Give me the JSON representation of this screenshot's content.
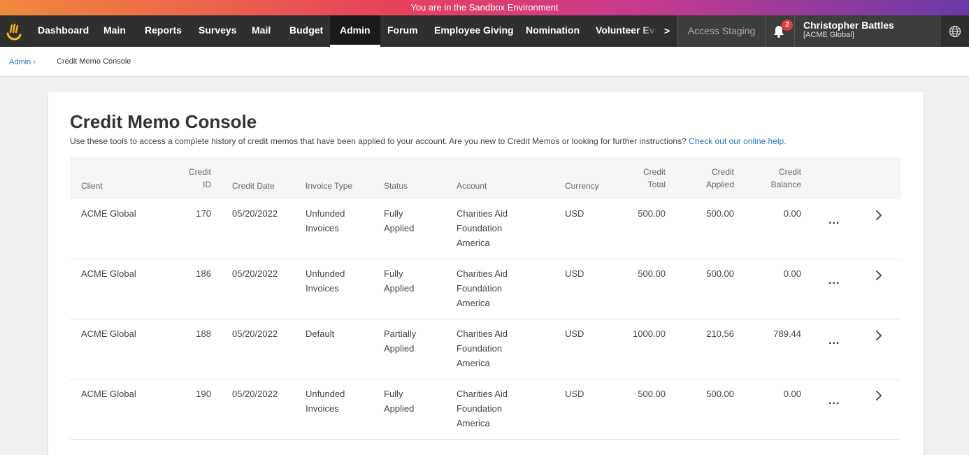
{
  "banner": {
    "text": "You are in the Sandbox Environment"
  },
  "nav": {
    "items": [
      "Dashboard",
      "Main",
      "Reports",
      "Surveys",
      "Mail",
      "Budget",
      "Admin",
      "Forum",
      "Employee Giving",
      "Nomination",
      "Volunteer Event"
    ],
    "active": "Admin",
    "more_label": ">",
    "access_staging": "Access Staging",
    "notification_count": "2",
    "user_name": "Christopher Battles",
    "user_org": "[ACME Global]"
  },
  "breadcrumb": {
    "parent": "Admin ›",
    "current": "Credit Memo Console"
  },
  "page": {
    "title": "Credit Memo Console",
    "description": "Use these tools to access a complete history of credit memos that have been applied to your account. Are you new to Credit Memos or looking for further instructions?",
    "help_link": "Check out our online help."
  },
  "table": {
    "headers": {
      "client": "Client",
      "credit_id_1": "Credit",
      "credit_id_2": "ID",
      "credit_date": "Credit Date",
      "invoice_type": "Invoice Type",
      "status": "Status",
      "account": "Account",
      "currency": "Currency",
      "credit_total_1": "Credit",
      "credit_total_2": "Total",
      "credit_applied_1": "Credit",
      "credit_applied_2": "Applied",
      "credit_balance_1": "Credit",
      "credit_balance_2": "Balance"
    },
    "rows": [
      {
        "client": "ACME Global",
        "id": "170",
        "date": "05/20/2022",
        "invoice_type_1": "Unfunded",
        "invoice_type_2": "Invoices",
        "status_1": "Fully",
        "status_2": "Applied",
        "account_1": "Charities Aid",
        "account_2": "Foundation",
        "account_3": "America",
        "currency": "USD",
        "total": "500.00",
        "applied": "500.00",
        "balance": "0.00"
      },
      {
        "client": "ACME Global",
        "id": "186",
        "date": "05/20/2022",
        "invoice_type_1": "Unfunded",
        "invoice_type_2": "Invoices",
        "status_1": "Fully",
        "status_2": "Applied",
        "account_1": "Charities Aid",
        "account_2": "Foundation",
        "account_3": "America",
        "currency": "USD",
        "total": "500.00",
        "applied": "500.00",
        "balance": "0.00"
      },
      {
        "client": "ACME Global",
        "id": "188",
        "date": "05/20/2022",
        "invoice_type_1": "Default",
        "invoice_type_2": "",
        "status_1": "Partially",
        "status_2": "Applied",
        "account_1": "Charities Aid",
        "account_2": "Foundation",
        "account_3": "America",
        "currency": "USD",
        "total": "1000.00",
        "applied": "210.56",
        "balance": "789.44"
      },
      {
        "client": "ACME Global",
        "id": "190",
        "date": "05/20/2022",
        "invoice_type_1": "Unfunded",
        "invoice_type_2": "Invoices",
        "status_1": "Fully",
        "status_2": "Applied",
        "account_1": "Charities Aid",
        "account_2": "Foundation",
        "account_3": "America",
        "currency": "USD",
        "total": "500.00",
        "applied": "500.00",
        "balance": "0.00"
      }
    ],
    "row_menu_label": "...",
    "row_open_label": ">"
  }
}
